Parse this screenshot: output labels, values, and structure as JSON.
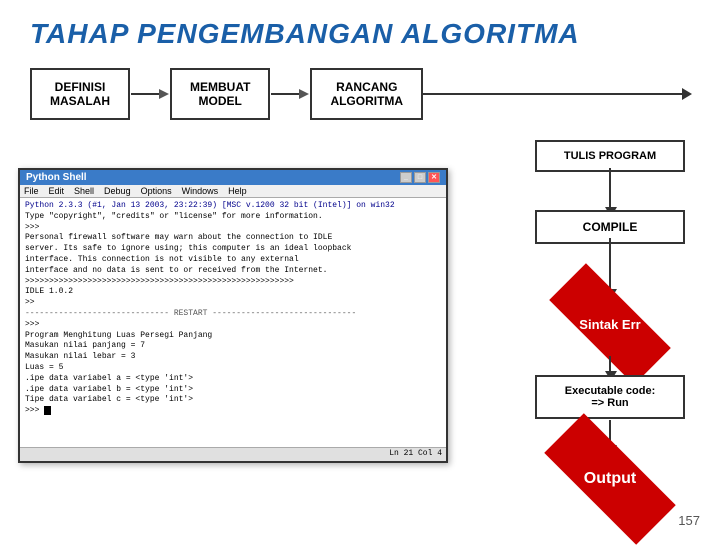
{
  "title": "TAHAP PENGEMBANGAN ALGORITMA",
  "flow": {
    "box1": "DEFINISI\nMASALAH",
    "box2": "MEMBUAT\nMODEL",
    "box3": "RANCANG\nALGORITMA"
  },
  "right_flow": {
    "tulis": "TULIS PROGRAM",
    "compile": "COMPILE",
    "sintak": "Sintak Err",
    "exec": "Executable code:\n=> Run",
    "output": "Output"
  },
  "shell": {
    "title": "Python Shell",
    "menu": [
      "File",
      "Edit",
      "Shell",
      "Debug",
      "Options",
      "Windows",
      "Help"
    ],
    "lines": [
      "Python 2.3.3 (#1, Jan 13 2003, 23:22:39) [MSC v.1200 32 bit (Intel)] on win32",
      "Type \"copyright\", \"credits\" or \"license\" for more information.",
      ">>>",
      "Personal firewall software may warn about the connection to IDLE",
      "server. Its safe to ignore using; this computer is an ideal loopback",
      "interface. This connection is not visible to any external",
      "interface and no data is sent to or received from the Internet.",
      ">>>>>>>>>>>>>>>>>>>>>>>>>>>>>>>>>>>>>>>>>>>>>>>>>>>>>>>",
      "IDLE 1.0.2",
      ">>",
      "---------- RESTART ----------",
      ">>>",
      "Program Menghitung Luas Persegi Panjang",
      "Masukan nilai panjang = 7",
      "Masukan nilai lebar = 3",
      "Luas = 5",
      ".ipe data variabel a = <type 'int'>",
      ".ipe data variabel b = <type 'int'>",
      "Tipe data variabel c = <type 'int'>",
      ">>>"
    ],
    "status": "Ln 21 Col 4"
  },
  "page_number": "157"
}
